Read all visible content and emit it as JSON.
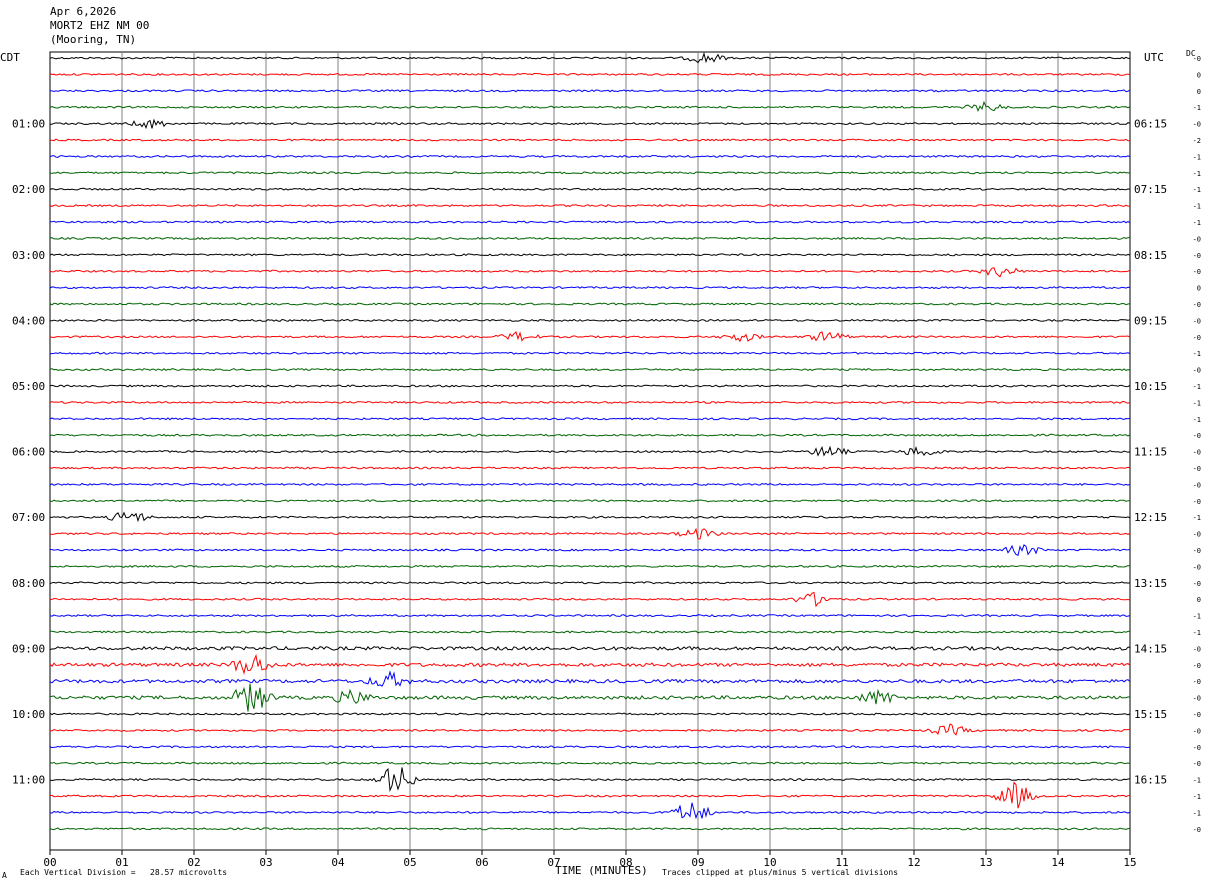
{
  "header": {
    "date": "Apr 6,2026",
    "station": "MORT2 EHZ NM 00",
    "location": "(Mooring, TN)"
  },
  "left_tz": "CDT",
  "right_tz": "UTC",
  "dc_label": "DC",
  "footer": {
    "scale": "Each Vertical Division =   28.57 microvolts",
    "clip": "Traces clipped at plus/minus 5 vertical divisions",
    "mark": "A"
  },
  "colors": {
    "trace_cycle": [
      "#000000",
      "#ff0000",
      "#0000ff",
      "#006400"
    ],
    "grid": "#808080"
  },
  "chart_data": {
    "type": "line",
    "xlabel": "TIME (MINUTES)",
    "x_ticks": [
      "00",
      "01",
      "02",
      "03",
      "04",
      "05",
      "06",
      "07",
      "08",
      "09",
      "10",
      "11",
      "12",
      "13",
      "14",
      "15"
    ],
    "xlim": [
      0,
      15
    ],
    "trace_count": 48,
    "left_time_labels": [
      "01:00",
      "02:00",
      "03:00",
      "04:00",
      "05:00",
      "06:00",
      "07:00",
      "08:00",
      "09:00",
      "10:00",
      "11:00"
    ],
    "right_time_labels": [
      "06:15",
      "07:15",
      "08:15",
      "09:15",
      "10:15",
      "11:15",
      "12:15",
      "13:15",
      "14:15",
      "15:15",
      "16:15"
    ],
    "dc_offsets": [
      "-0",
      "0",
      "0",
      "-1",
      "-0",
      "-2",
      "-1",
      "-1",
      "-1",
      "-1",
      "-1",
      "-0",
      "-0",
      "-0",
      "0",
      "-0",
      "-0",
      "-0",
      "-1",
      "-0",
      "-1",
      "-1",
      "-1",
      "-0",
      "-0",
      "-0",
      "-0",
      "-0",
      "-1",
      "-0",
      "-0",
      "-0",
      "-0",
      "0",
      "-1",
      "-1",
      "-0",
      "-0",
      "-0",
      "-0",
      "-0",
      "-0",
      "-0",
      "-0",
      "-1",
      "-1",
      "-1",
      "-0"
    ],
    "events": [
      {
        "trace": 0,
        "minute": 9.1,
        "amp": 1.2
      },
      {
        "trace": 3,
        "minute": 13.0,
        "amp": 1.0
      },
      {
        "trace": 4,
        "minute": 1.4,
        "amp": 1.0
      },
      {
        "trace": 13,
        "minute": 13.2,
        "amp": 1.2
      },
      {
        "trace": 17,
        "minute": 6.5,
        "amp": 1.0
      },
      {
        "trace": 17,
        "minute": 9.6,
        "amp": 1.0
      },
      {
        "trace": 17,
        "minute": 10.8,
        "amp": 1.2
      },
      {
        "trace": 24,
        "minute": 10.8,
        "amp": 1.2
      },
      {
        "trace": 24,
        "minute": 12.1,
        "amp": 1.2
      },
      {
        "trace": 28,
        "minute": 1.1,
        "amp": 1.5
      },
      {
        "trace": 29,
        "minute": 9.0,
        "amp": 1.2
      },
      {
        "trace": 30,
        "minute": 13.5,
        "amp": 1.2
      },
      {
        "trace": 33,
        "minute": 10.6,
        "amp": 1.5
      },
      {
        "trace": 37,
        "minute": 2.8,
        "amp": 2.5
      },
      {
        "trace": 38,
        "minute": 4.7,
        "amp": 1.8
      },
      {
        "trace": 39,
        "minute": 2.8,
        "amp": 3.5
      },
      {
        "trace": 39,
        "minute": 11.5,
        "amp": 1.5
      },
      {
        "trace": 39,
        "minute": 4.2,
        "amp": 1.5
      },
      {
        "trace": 41,
        "minute": 12.5,
        "amp": 1.2
      },
      {
        "trace": 44,
        "minute": 4.8,
        "amp": 3.5
      },
      {
        "trace": 45,
        "minute": 13.4,
        "amp": 3.0
      },
      {
        "trace": 46,
        "minute": 8.9,
        "amp": 2.5
      }
    ]
  }
}
